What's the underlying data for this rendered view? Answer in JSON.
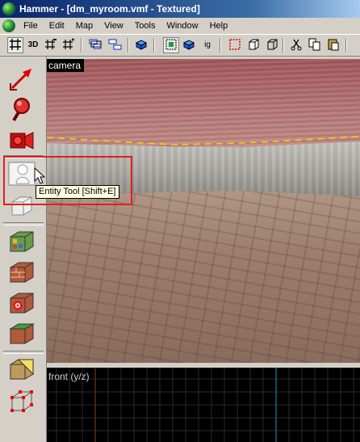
{
  "window": {
    "title": "Hammer - [dm_myroom.vmf - Textured]"
  },
  "menu": {
    "items": [
      "File",
      "Edit",
      "Map",
      "View",
      "Tools",
      "Window",
      "Help"
    ]
  },
  "toolbar": {
    "grid_3d_label": "3D",
    "ig_label": "ig",
    "icons": [
      "grid-icon",
      "grid-3d-icon",
      "grid-smaller-icon",
      "grid-larger-icon",
      "group-icon",
      "ungroup-icon",
      "hide-icon",
      "texture-lock-icon",
      "snap-icon",
      "ig-icon",
      "carve-icon",
      "hollow-icon",
      "cube-icon",
      "cut-icon",
      "copy-icon",
      "paste-icon"
    ]
  },
  "tools": {
    "icons": [
      "selection-tool-icon",
      "magnify-tool-icon",
      "camera-tool-icon",
      "entity-tool-icon",
      "block-tool-icon",
      "texture-application-icon",
      "apply-texture-icon",
      "decal-icon",
      "overlay-icon",
      "clipping-tool-icon",
      "vertex-tool-icon"
    ],
    "tooltip": "Entity Tool [Shift+E]"
  },
  "viewports": {
    "camera_label": "camera",
    "front_label": "front (y/z)"
  },
  "colors": {
    "highlight": "#e02020",
    "tooltip_bg": "#ffffe1",
    "titlebar": "#0a246a"
  }
}
